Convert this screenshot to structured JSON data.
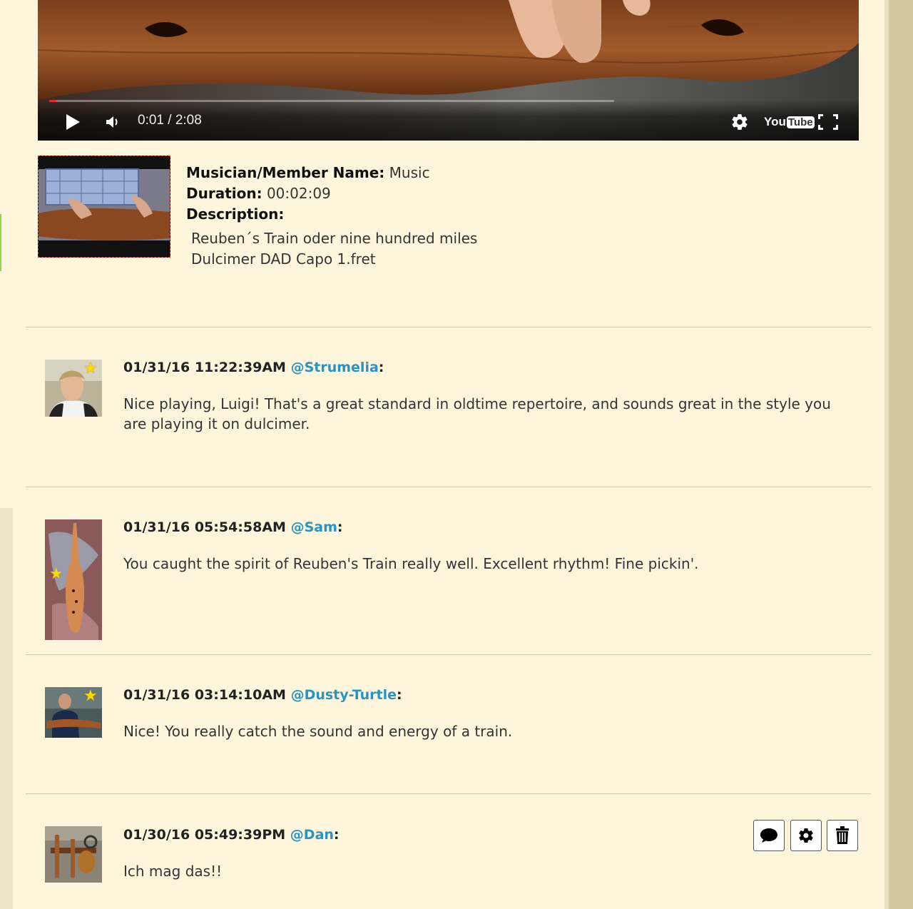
{
  "player": {
    "time_display": "0:01 / 2:08",
    "progress_fraction": 0.0125,
    "logo_you": "You",
    "logo_tube": "Tube",
    "icons": [
      "play-icon",
      "volume-icon",
      "settings-gear-icon",
      "youtube-logo",
      "fullscreen-icon"
    ]
  },
  "info": {
    "member_label": "Musician/Member Name:",
    "member_value": "Music",
    "duration_label": "Duration:",
    "duration_value": "00:02:09",
    "description_label": "Description:",
    "description_lines": [
      "Reuben´s Train oder nine hundred miles",
      "Dulcimer DAD Capo 1.fret"
    ]
  },
  "comments": [
    {
      "timestamp": "01/31/16 11:22:39AM",
      "user": "@Strumelia",
      "text": "Nice playing, Luigi!  That's a great standard in oldtime repertoire, and sounds great in the style you are playing it on dulcimer."
    },
    {
      "timestamp": "01/31/16 05:54:58AM",
      "user": "@Sam",
      "text": "You caught the spirit of Reuben's Train really well. Excellent rhythm! Fine pickin'."
    },
    {
      "timestamp": "01/31/16 03:14:10AM",
      "user": "@Dusty-Turtle",
      "text": "Nice! You really catch the sound and energy of a train."
    },
    {
      "timestamp": "01/30/16 05:49:39PM",
      "user": "@Dan",
      "text": "Ich mag das!!"
    }
  ],
  "actions": {
    "icons": [
      "reply-speech-bubble-icon",
      "settings-gear-icon",
      "trash-icon"
    ]
  },
  "colors": {
    "background": "#fdf6dc",
    "username_link": "#2a93c2",
    "progress_red": "#e52d27",
    "star": "#ffd800"
  }
}
